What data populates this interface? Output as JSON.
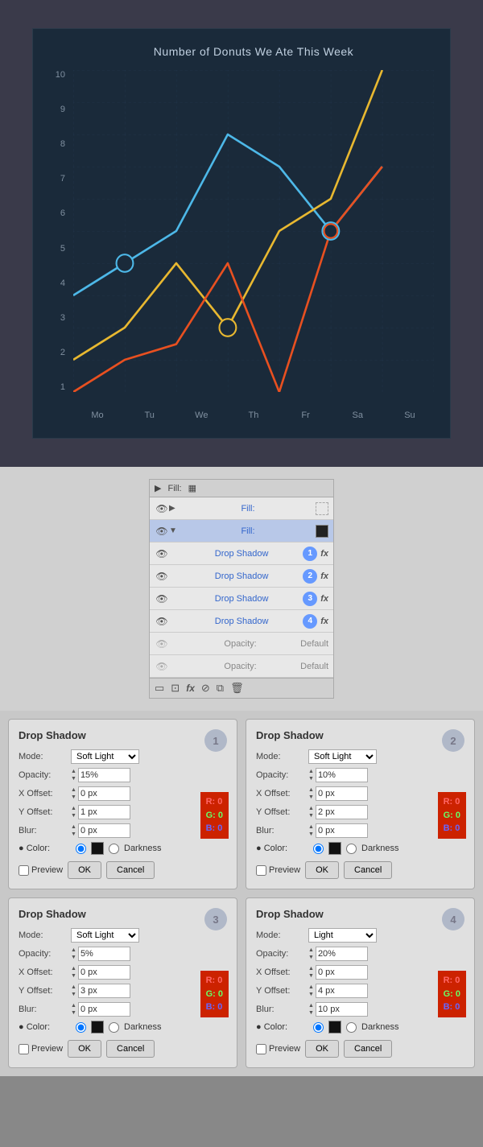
{
  "chart": {
    "title": "Number of Donuts We Ate This Week",
    "yLabels": [
      "1",
      "2",
      "3",
      "4",
      "5",
      "6",
      "7",
      "8",
      "9",
      "10"
    ],
    "xLabels": [
      "Mo",
      "Tu",
      "We",
      "Th",
      "Fr",
      "Sa",
      "Su"
    ],
    "colors": {
      "blue": "#4db8e8",
      "yellow": "#e8b830",
      "orange": "#e85020"
    }
  },
  "layers": {
    "header": "Fill:",
    "rows": [
      {
        "eye": true,
        "arrow": false,
        "name": "Fill:",
        "swatch": false,
        "badge": null,
        "fx": false,
        "selected": false
      },
      {
        "eye": true,
        "arrow": true,
        "name": "Fill:",
        "swatch": true,
        "badge": null,
        "fx": false,
        "selected": true
      },
      {
        "eye": true,
        "arrow": false,
        "name": "Drop Shadow",
        "badge": "1",
        "fx": true,
        "selected": false
      },
      {
        "eye": true,
        "arrow": false,
        "name": "Drop Shadow",
        "badge": "2",
        "fx": true,
        "selected": false
      },
      {
        "eye": true,
        "arrow": false,
        "name": "Drop Shadow",
        "badge": "3",
        "fx": true,
        "selected": false
      },
      {
        "eye": true,
        "arrow": false,
        "name": "Drop Shadow",
        "badge": "4",
        "fx": true,
        "selected": false
      },
      {
        "eye": false,
        "arrow": false,
        "name": "Opacity:",
        "value": "Default",
        "selected": false
      },
      {
        "eye": false,
        "arrow": false,
        "name": "Opacity:",
        "value": "Default",
        "selected": false
      }
    ]
  },
  "panels": [
    {
      "number": "1",
      "title": "Drop Shadow",
      "mode": "Soft Light",
      "opacity": "15%",
      "xOffset": "0 px",
      "yOffset": "1 px",
      "blur": "0 px",
      "r": "0",
      "g": "0",
      "b": "0"
    },
    {
      "number": "2",
      "title": "Drop Shadow",
      "mode": "Soft Light",
      "opacity": "10%",
      "xOffset": "0 px",
      "yOffset": "2 px",
      "blur": "0 px",
      "r": "0",
      "g": "0",
      "b": "0"
    },
    {
      "number": "3",
      "title": "Drop Shadow",
      "mode": "Soft Light",
      "opacity": "5%",
      "xOffset": "0 px",
      "yOffset": "3 px",
      "blur": "0 px",
      "r": "0",
      "g": "0",
      "b": "0"
    },
    {
      "number": "4",
      "title": "Drop Shadow",
      "mode": "Light",
      "opacity": "20%",
      "xOffset": "0 px",
      "yOffset": "4 px",
      "blur": "10 px",
      "r": "0",
      "g": "0",
      "b": "0"
    }
  ],
  "labels": {
    "mode": "Mode:",
    "opacity": "Opacity:",
    "xOffset": "X Offset:",
    "yOffset": "Y Offset:",
    "blur": "Blur:",
    "color": "Color:",
    "darkness": "Darkness",
    "preview": "Preview",
    "ok": "OK",
    "cancel": "Cancel"
  }
}
